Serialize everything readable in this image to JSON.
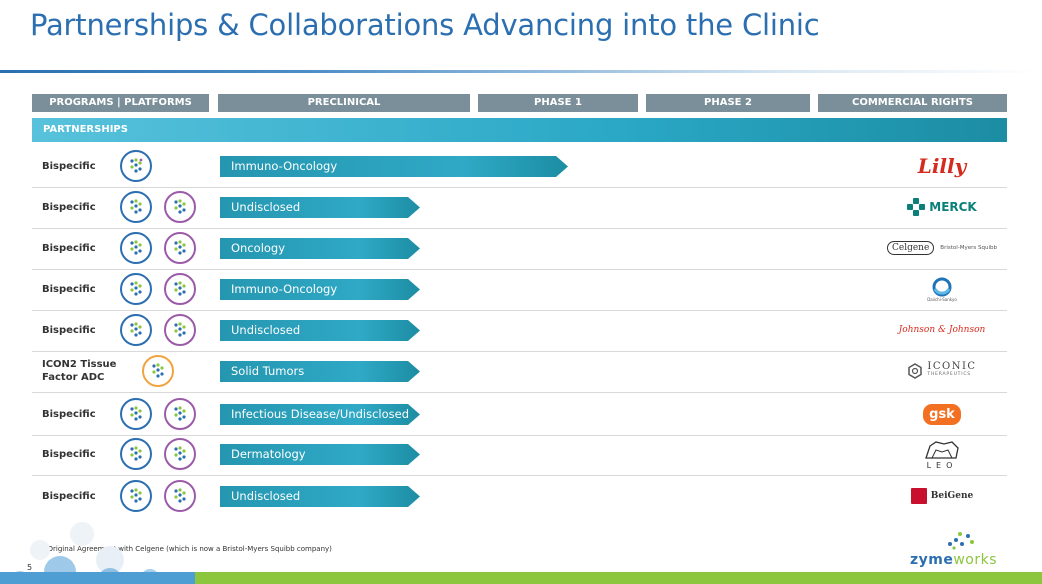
{
  "title": "Partnerships & Collaborations Advancing into the Clinic",
  "header": [
    "PROGRAMS | PLATFORMS",
    "PRECLINICAL",
    "PHASE 1",
    "PHASE 2",
    "COMMERCIAL RIGHTS"
  ],
  "section_label": "PARTNERSHIPS",
  "rows": [
    {
      "program": "Bispecific",
      "indication": "Immuno-Oncology",
      "progress": "phase-1",
      "partner": "Lilly"
    },
    {
      "program": "Bispecific",
      "indication": "Undisclosed",
      "progress": "preclinical",
      "partner": "MERCK"
    },
    {
      "program": "Bispecific",
      "indication": "Oncology",
      "progress": "preclinical",
      "partner": "Celgene",
      "partner_sub": "Bristol-Myers Squibb"
    },
    {
      "program": "Bispecific",
      "indication": "Immuno-Oncology",
      "progress": "preclinical",
      "partner": "Daiichi-Sankyo"
    },
    {
      "program": "Bispecific",
      "indication": "Undisclosed",
      "progress": "preclinical",
      "partner": "Johnson & Johnson"
    },
    {
      "program": "ICON2 Tissue Factor ADC",
      "indication": "Solid Tumors",
      "progress": "preclinical",
      "partner": "ICONIC",
      "partner_sub": "THERAPEUTICS"
    },
    {
      "program": "Bispecific",
      "indication": "Infectious Disease/Undisclosed",
      "progress": "preclinical",
      "partner": "gsk"
    },
    {
      "program": "Bispecific",
      "indication": "Dermatology",
      "progress": "preclinical",
      "partner": "LEO"
    },
    {
      "program": "Bispecific",
      "indication": "Undisclosed",
      "progress": "preclinical",
      "partner": "BeiGene"
    }
  ],
  "footnote": "*Original Agreement with Celgene (which is now a Bristol-Myers Squibb company)",
  "page_number": "5",
  "brand": {
    "part1": "zyme",
    "part2": "works"
  },
  "colors": {
    "title": "#2c6fb1",
    "header": "#7a8f99",
    "teal": "#2aa8c6",
    "green": "#8cc63f"
  }
}
